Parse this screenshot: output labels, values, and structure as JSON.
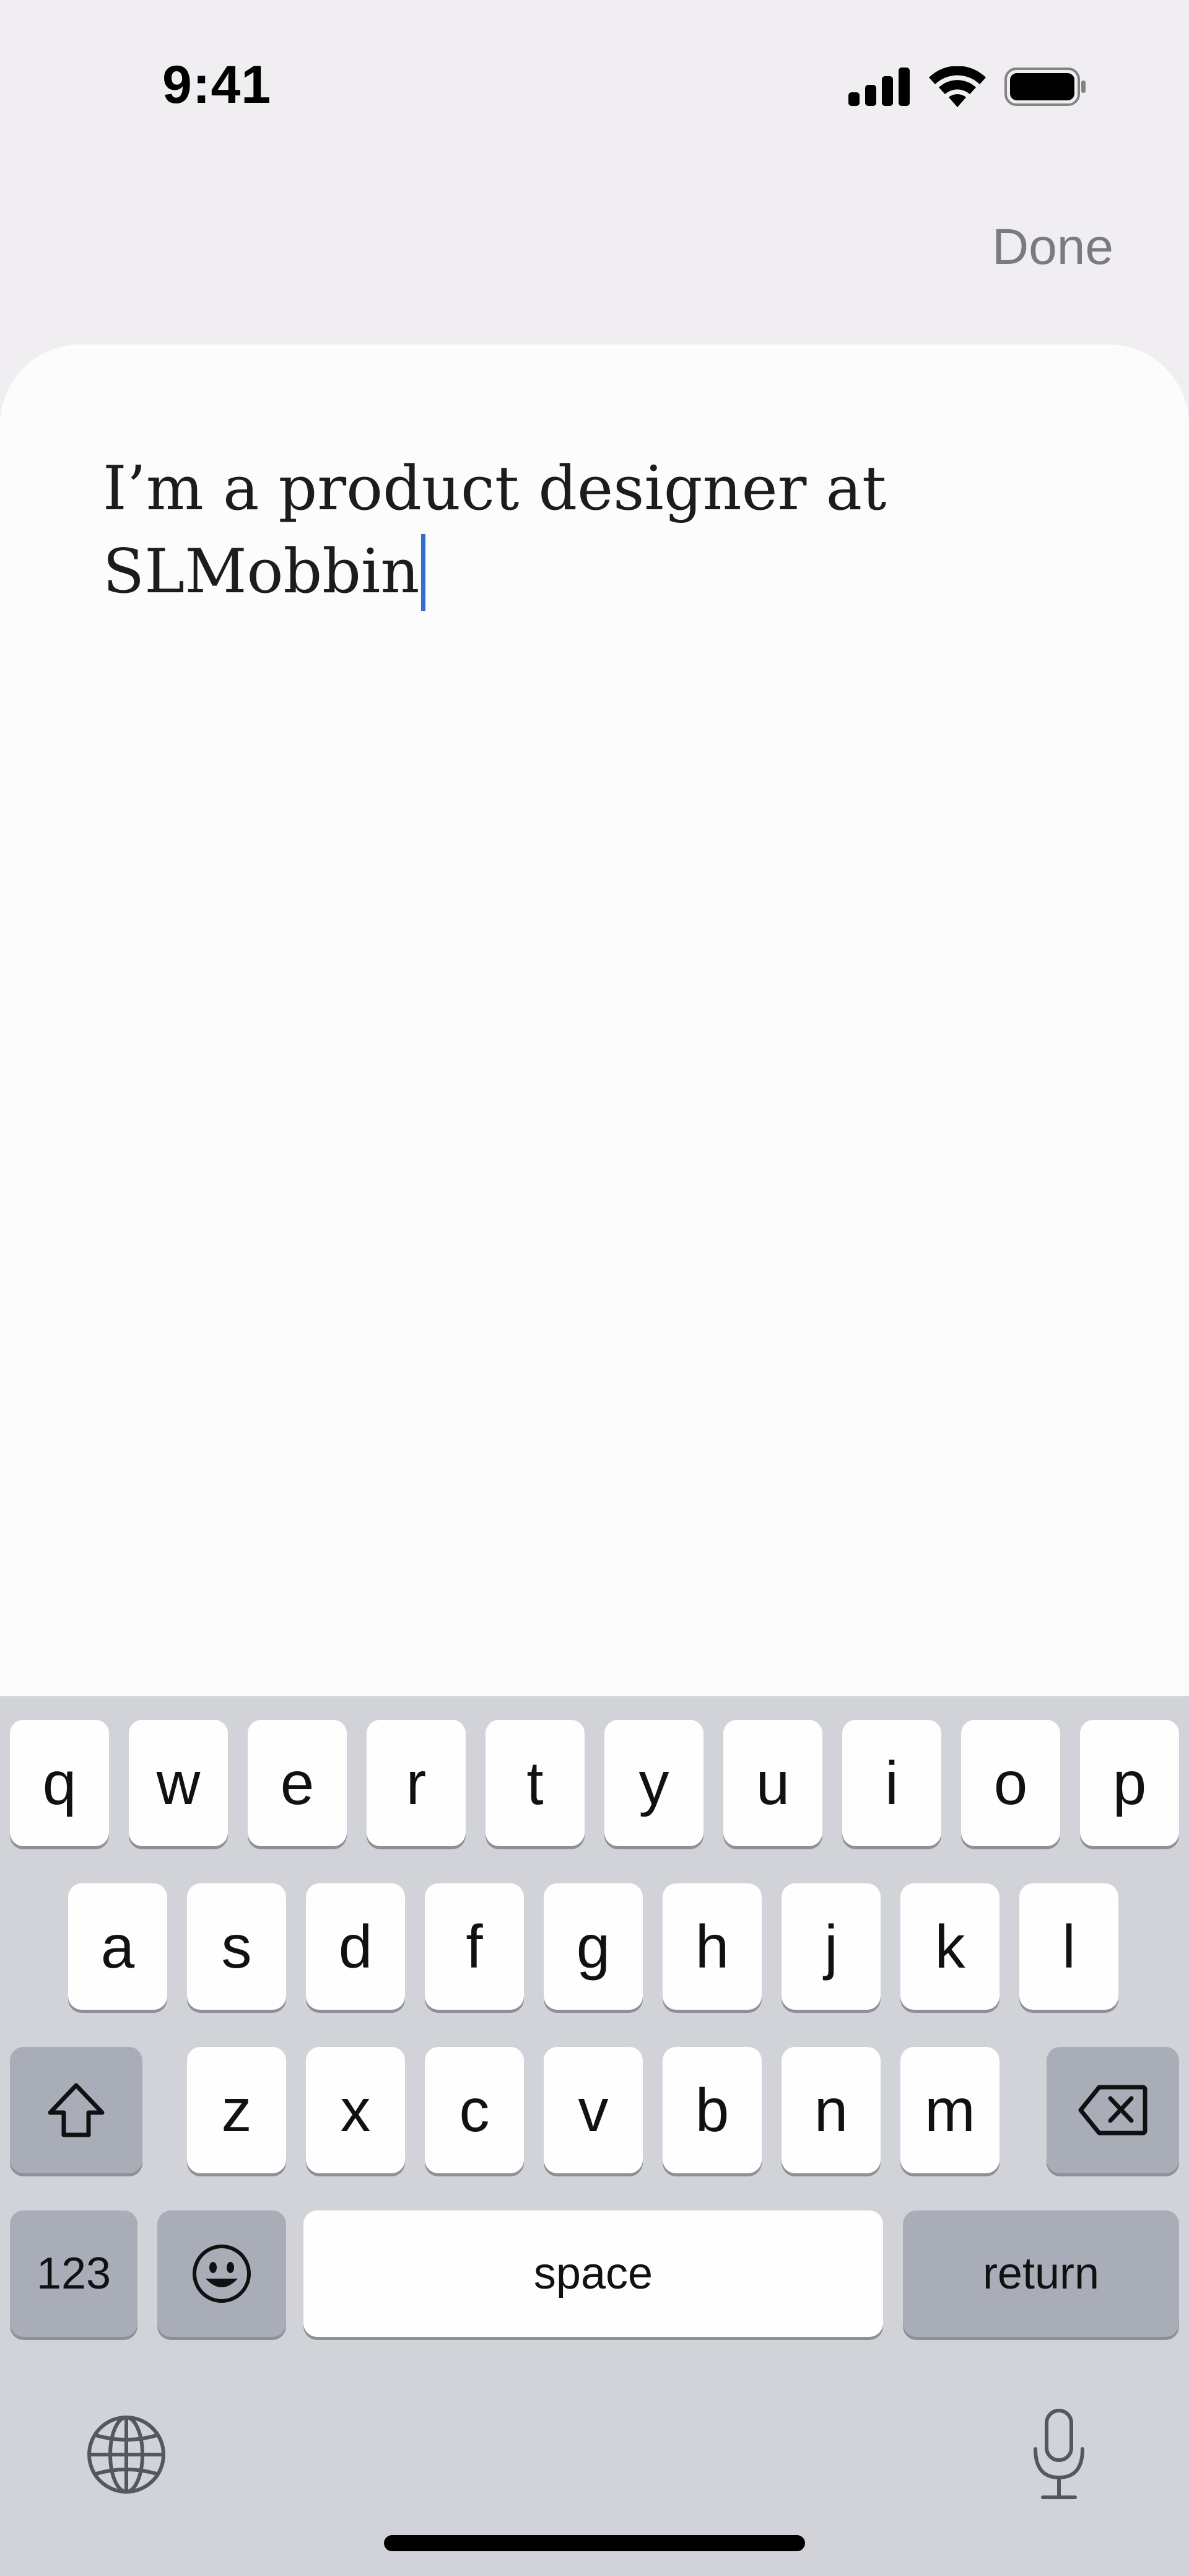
{
  "status_bar": {
    "time": "9:41",
    "icons": [
      "signal-icon",
      "wifi-icon",
      "battery-icon"
    ]
  },
  "header": {
    "done_label": "Done"
  },
  "editor": {
    "line1": "I’m a product designer at",
    "line2": "SLMobbin"
  },
  "keyboard": {
    "row1": [
      "q",
      "w",
      "e",
      "r",
      "t",
      "y",
      "u",
      "i",
      "o",
      "p"
    ],
    "row2": [
      "a",
      "s",
      "d",
      "f",
      "g",
      "h",
      "j",
      "k",
      "l"
    ],
    "row3": [
      "z",
      "x",
      "c",
      "v",
      "b",
      "n",
      "m"
    ],
    "numbers_label": "123",
    "space_label": "space",
    "return_label": "return",
    "icons": [
      "shift-icon",
      "delete-icon",
      "emoji-icon",
      "globe-icon",
      "microphone-icon"
    ]
  },
  "colors": {
    "caret": "#2f6fdc",
    "keyboard_bg": "#d2d3d8",
    "dark_key": "#a9adb8"
  }
}
